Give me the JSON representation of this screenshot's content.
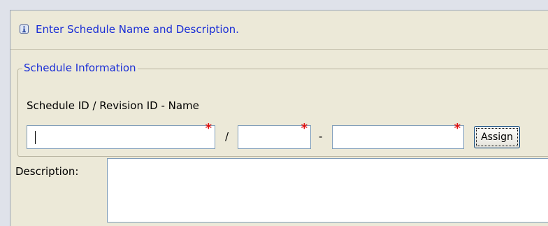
{
  "info_bar": {
    "icon": "info-icon",
    "message": "Enter Schedule Name and Description."
  },
  "schedule_group": {
    "legend": "Schedule Information",
    "field_label": "Schedule ID / Revision ID - Name",
    "schedule_id": {
      "value": "",
      "required": true
    },
    "separator_slash": "/",
    "revision_id": {
      "value": "",
      "required": true
    },
    "separator_dash": "-",
    "name": {
      "value": "",
      "required": true
    },
    "required_marker": "*",
    "assign_button": "Assign"
  },
  "description": {
    "label": "Description:",
    "value": ""
  },
  "colors": {
    "info_text": "#1a2ed6",
    "required_marker": "#e01010",
    "panel_bg": "#ece9d8",
    "input_border": "#7f9db9"
  }
}
